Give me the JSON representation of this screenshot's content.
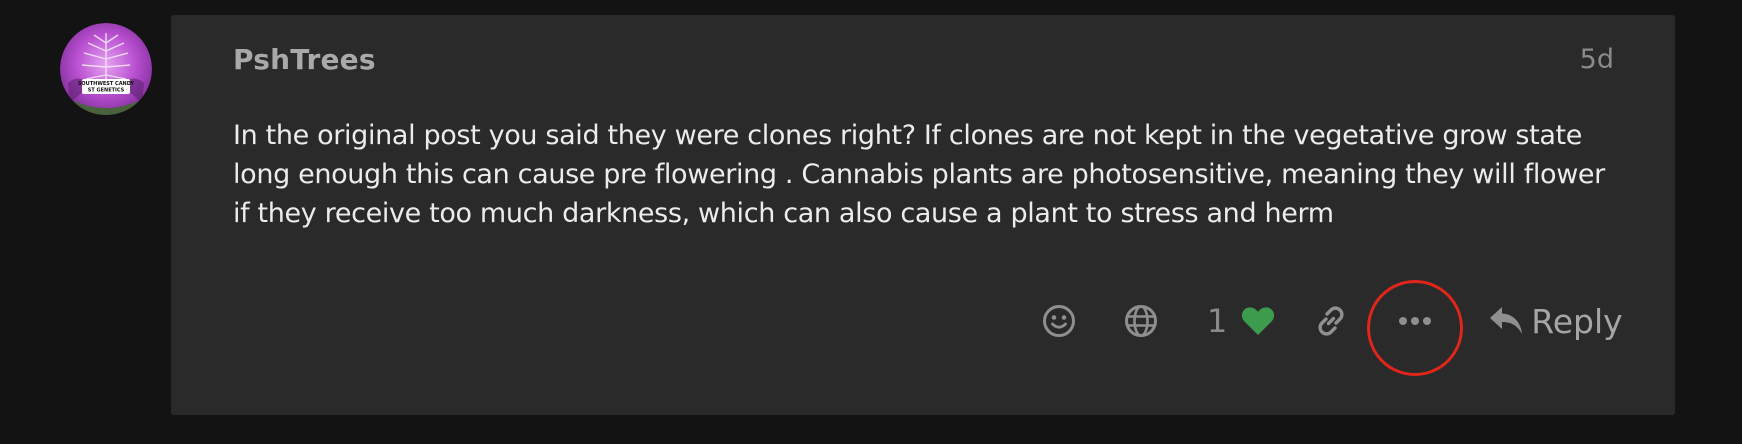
{
  "post": {
    "username": "PshTrees",
    "date": "5d",
    "body": "In the original post you said they were clones right? If clones are not kept in the vegetative grow state long enough this can cause pre flowering . Cannabis plants are photosensitive, meaning they will flower if they receive too much darkness, which can also cause a plant to stress and herm",
    "avatar_badge_line1": "SOUTHWEST CANDY",
    "avatar_badge_line2": "ST GENETICS"
  },
  "actions": {
    "react_icon": "smile-icon",
    "translate_icon": "globe-icon",
    "like_count": "1",
    "like_icon": "heart-icon",
    "like_color": "#3d9b4d",
    "share_icon": "link-icon",
    "more_icon": "ellipsis-icon",
    "reply_icon": "reply-arrow-icon",
    "reply_label": "Reply",
    "highlight_color": "#e0261b"
  }
}
